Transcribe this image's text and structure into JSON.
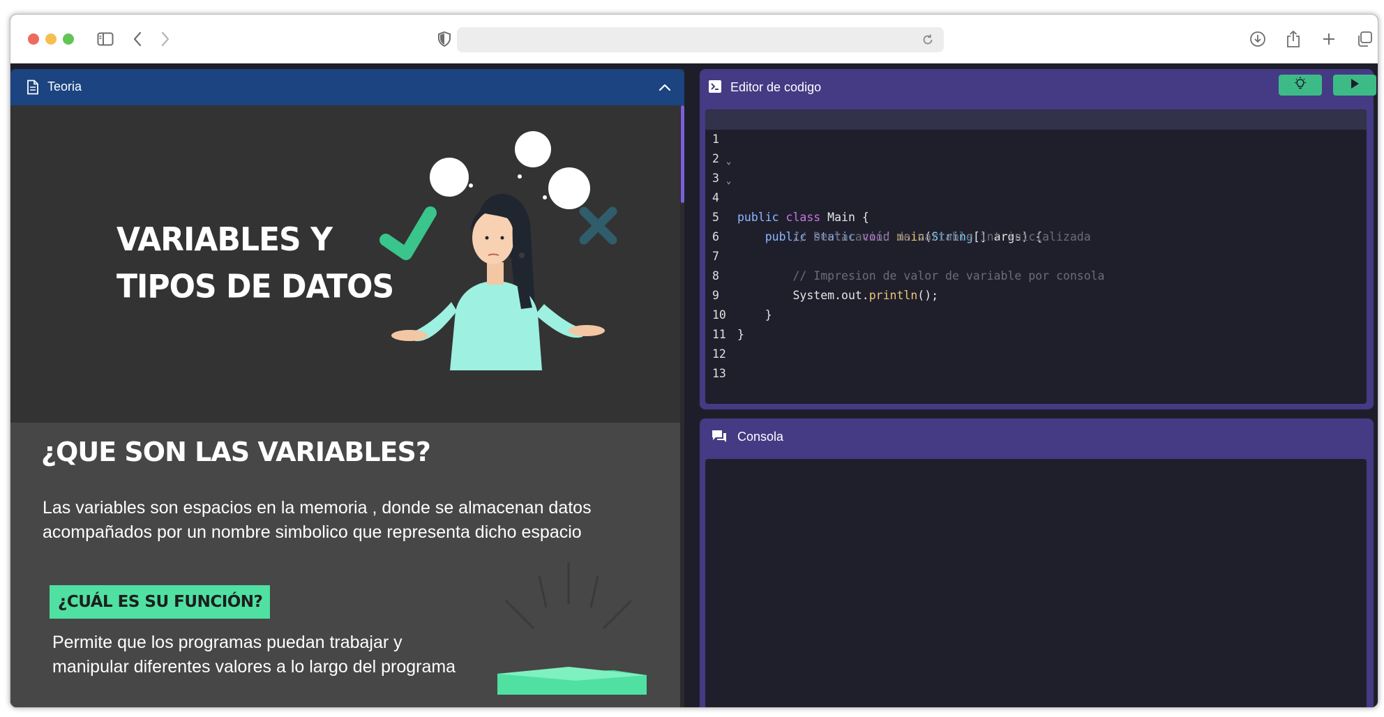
{
  "browser": {
    "address": ""
  },
  "theory_panel": {
    "title": "Teoria",
    "hero_title_line1": "VARIABLES Y",
    "hero_title_line2": "TIPOS DE DATOS",
    "section_title": "¿QUE SON LAS VARIABLES?",
    "section_text_line1": "Las variables son espacios en la memoria , donde se almacenan datos",
    "section_text_line2": "acompañados por un nombre simbolico que representa dicho espacio",
    "function_badge": "¿CUÁL ES SU FUNCIÓN?",
    "function_text_line1": "Permite que los programas puedan trabajar y",
    "function_text_line2": "manipular diferentes valores a lo largo del programa"
  },
  "editor": {
    "title": "Editor de codigo",
    "line_numbers": [
      "1",
      "2",
      "3",
      "4",
      "5",
      "6",
      "7",
      "8",
      "9",
      "10",
      "11",
      "12",
      "13"
    ],
    "code": {
      "l3_kw1": "public",
      "l3_kw2": "class",
      "l3_rest": " Main {",
      "l4_indent": "    ",
      "l4_kw1": "public",
      "l4_kw2": "static",
      "l4_kw3": "void",
      "l4_fn": "main",
      "l4_open": "(",
      "l4_type": "String",
      "l4_rest": "[] args) {",
      "l5": "        // Declaración de variable int inicializada",
      "l7": "        // Impresion de valor de variable por consola",
      "l8_a": "        System.out.",
      "l8_fn": "println",
      "l8_b": "();",
      "l9": "    }",
      "l10": "}"
    },
    "colors": {
      "panel": "#453a84",
      "code_bg": "#1f1f2c",
      "button": "#3dbb87"
    }
  },
  "console": {
    "title": "Consola"
  }
}
